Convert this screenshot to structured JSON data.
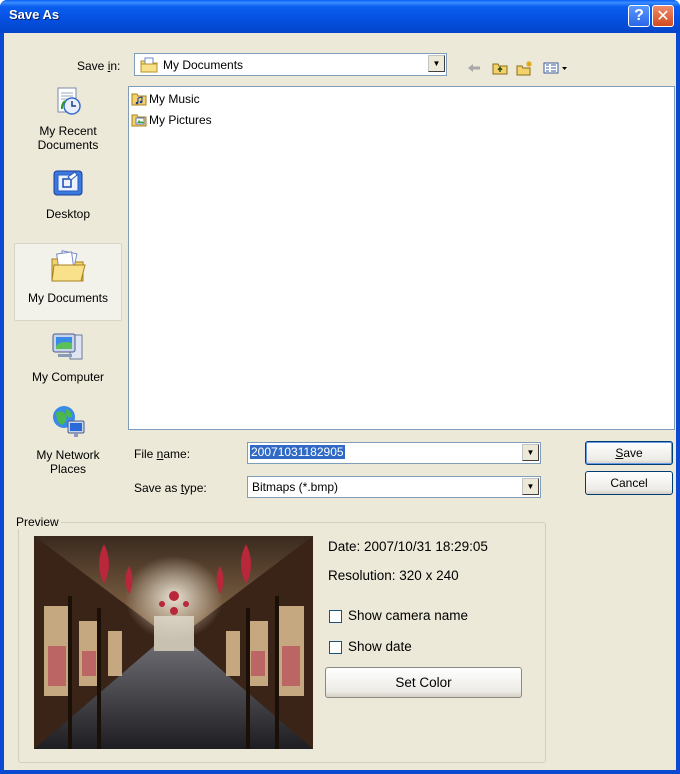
{
  "window": {
    "title": "Save As",
    "help_glyph": "?",
    "close_glyph": "✕"
  },
  "toolbar": {
    "save_in_prefix": "Save ",
    "save_in_key": "i",
    "save_in_suffix": "n:",
    "location": "My Documents",
    "back_icon": "back-arrow-icon",
    "up_icon": "up-folder-icon",
    "new_folder_icon": "new-folder-icon",
    "views_icon": "views-menu-icon"
  },
  "places": [
    {
      "line1": "My Recent",
      "line2": "Documents",
      "icon": "recent-documents-icon"
    },
    {
      "line1": "Desktop",
      "line2": "",
      "icon": "desktop-icon"
    },
    {
      "line1": "My Documents",
      "line2": "",
      "icon": "my-documents-icon",
      "selected": true
    },
    {
      "line1": "My Computer",
      "line2": "",
      "icon": "my-computer-icon"
    },
    {
      "line1": "My Network",
      "line2": "Places",
      "icon": "network-places-icon"
    }
  ],
  "files": [
    {
      "name": "My Music",
      "icon": "music-folder-icon"
    },
    {
      "name": "My Pictures",
      "icon": "pictures-folder-icon"
    }
  ],
  "form": {
    "file_name_prefix": "File ",
    "file_name_key": "n",
    "file_name_suffix": "ame:",
    "file_name_value": "20071031182905",
    "type_prefix": "Save as ",
    "type_key": "t",
    "type_suffix": "ype:",
    "type_value": "Bitmaps (*.bmp)"
  },
  "buttons": {
    "save_key": "S",
    "save_rest": "ave",
    "cancel": "Cancel"
  },
  "preview": {
    "legend": "Preview",
    "date": "Date: 2007/10/31 18:29:05",
    "resolution": "Resolution: 320 x 240",
    "show_camera_name": "Show camera name",
    "show_camera_name_checked": false,
    "show_date": "Show date",
    "show_date_checked": false,
    "set_color": "Set Color"
  },
  "colors": {
    "title_bar": "#0a5ef0",
    "dialog_bg": "#ece9d8",
    "selection": "#316ac5"
  }
}
